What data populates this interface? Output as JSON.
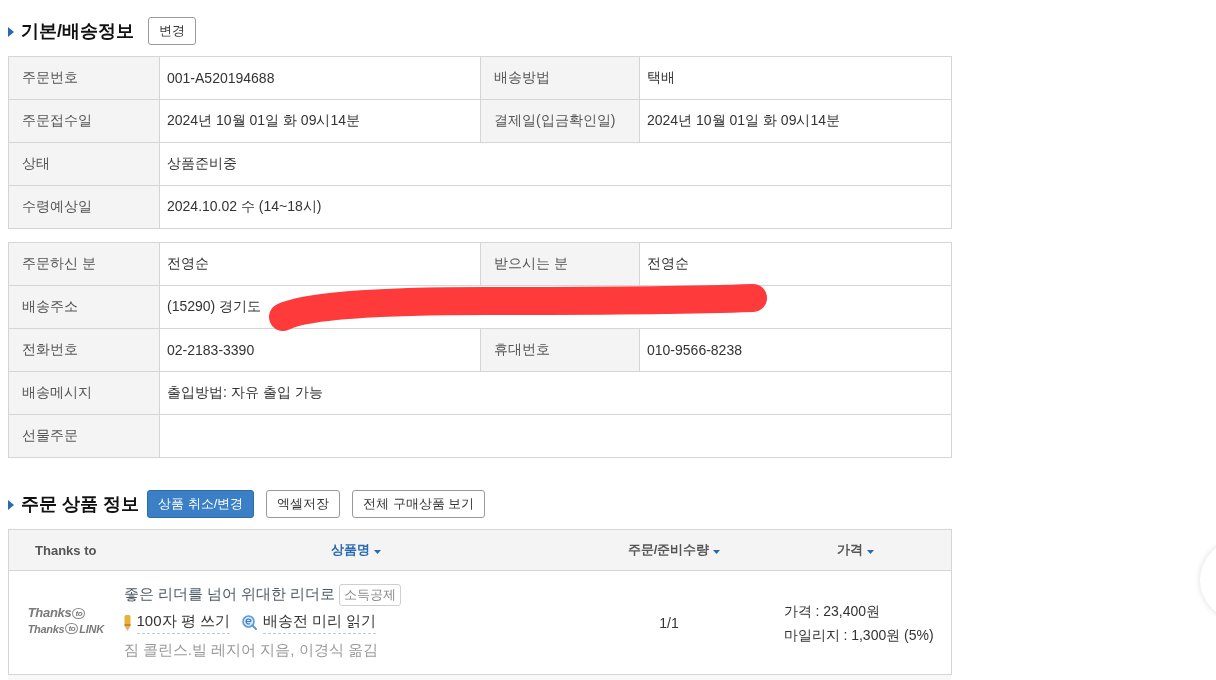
{
  "basic_info": {
    "title": "기본/배송정보",
    "change_button": "변경",
    "tables": [
      {
        "rows": [
          {
            "cells": [
              {
                "label": "주문번호",
                "value": "001-A520194688"
              },
              {
                "label": "배송방법",
                "value": "택배"
              }
            ]
          },
          {
            "cells": [
              {
                "label": "주문접수일",
                "value": "2024년 10월 01일 화 09시14분"
              },
              {
                "label": "결제일(입금확인일)",
                "value": "2024년 10월 01일 화 09시14분"
              }
            ]
          },
          {
            "cells": [
              {
                "label": "상태",
                "value": "상품준비중"
              }
            ]
          },
          {
            "cells": [
              {
                "label": "수령예상일",
                "value": "2024.10.02 수 (14~18시)"
              }
            ]
          }
        ]
      },
      {
        "rows": [
          {
            "cells": [
              {
                "label": "주문하신 분",
                "value": "전영순"
              },
              {
                "label": "받으시는 분",
                "value": "전영순"
              }
            ]
          },
          {
            "cells": [
              {
                "label": "배송주소",
                "value": "(15290) 경기도",
                "redacted": true
              }
            ]
          },
          {
            "cells": [
              {
                "label": "전화번호",
                "value": "02-2183-3390"
              },
              {
                "label": "휴대번호",
                "value": "010-9566-8238"
              }
            ]
          },
          {
            "cells": [
              {
                "label": "배송메시지",
                "value": "출입방법: 자유 출입 가능"
              }
            ]
          },
          {
            "cells": [
              {
                "label": "선물주문"
              }
            ]
          }
        ]
      }
    ]
  },
  "order_items": {
    "title": "주문 상품 정보",
    "buttons": [
      {
        "label": "상품 취소/변경",
        "primary": true
      },
      {
        "label": "엑셀저장",
        "primary": false
      },
      {
        "label": "전체 구매상품 보기",
        "primary": false
      }
    ],
    "table": {
      "columns": [
        {
          "label": "Thanks to",
          "sortable": false,
          "active": false
        },
        {
          "label": "상품명",
          "sortable": true,
          "active": true
        },
        {
          "label": "주문/준비수량",
          "sortable": true,
          "active": false
        },
        {
          "label": "가격",
          "sortable": true,
          "active": false
        }
      ],
      "rows": [
        {
          "thanks_logo": {
            "lines": [
              [
                {
                  "text": "Thanks",
                  "kind": "word"
                },
                {
                  "text": "to",
                  "kind": "circle"
                }
              ],
              [
                {
                  "text": "Thanks",
                  "kind": "word"
                },
                {
                  "text": "to",
                  "kind": "circle"
                },
                {
                  "text": "LINK",
                  "kind": "word"
                }
              ]
            ]
          },
          "title": "좋은 리더를 넘어 위대한 리더로",
          "badge": "소득공제",
          "links": [
            {
              "kind": "review",
              "label": "100자 평 쓰기"
            },
            {
              "kind": "preview",
              "label": "배송전 미리 읽기"
            }
          ],
          "author": "짐 콜린스.빌 레지어 지음, 이경식 옮김",
          "quantity": "1/1",
          "price": "가격 : 23,400원",
          "mileage": "마일리지 : 1,300원 (5%)"
        }
      ]
    }
  }
}
